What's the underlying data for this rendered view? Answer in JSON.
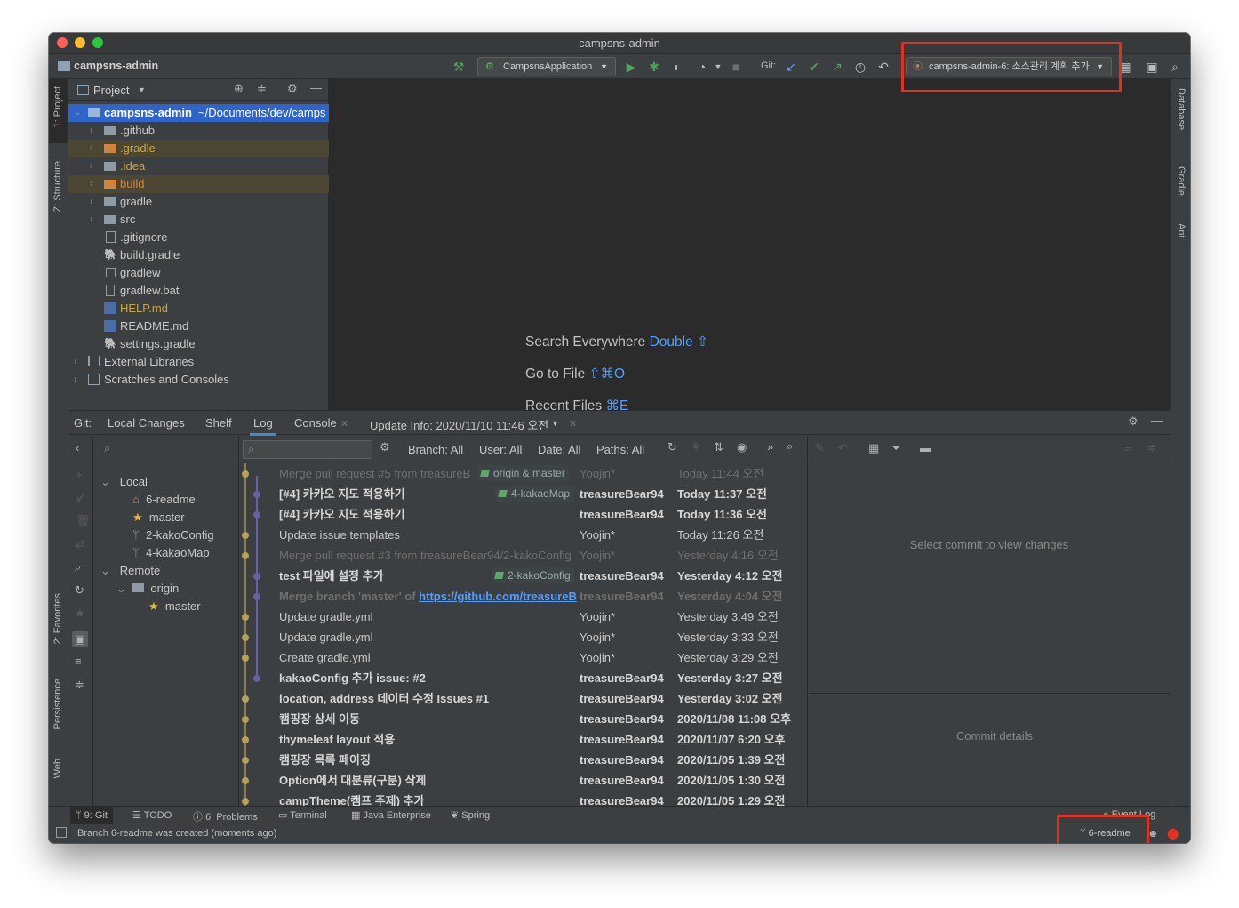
{
  "window": {
    "title": "campsns-admin"
  },
  "navbar": {
    "project": "campsns-admin",
    "run_config": "CampsnsApplication",
    "git_label": "Git:",
    "task": "campsns-admin-6: 소스관리 계획 추가"
  },
  "left_stripe": {
    "project": "1: Project",
    "structure": "Z: Structure",
    "favorites": "2: Favorites",
    "persistence": "Persistence",
    "web": "Web"
  },
  "right_stripe": {
    "database": "Database",
    "gradle": "Gradle",
    "ant": "Ant"
  },
  "project_panel": {
    "title": "Project",
    "root": {
      "name": "campsns-admin",
      "path": "~/Documents/dev/camps"
    },
    "items": [
      {
        "label": ".github"
      },
      {
        "label": ".gradle"
      },
      {
        "label": ".idea"
      },
      {
        "label": "build"
      },
      {
        "label": "gradle"
      },
      {
        "label": "src"
      },
      {
        "label": ".gitignore"
      },
      {
        "label": "build.gradle"
      },
      {
        "label": "gradlew"
      },
      {
        "label": "gradlew.bat"
      },
      {
        "label": "HELP.md"
      },
      {
        "label": "README.md"
      },
      {
        "label": "settings.gradle"
      },
      {
        "label": "External Libraries"
      },
      {
        "label": "Scratches and Consoles"
      }
    ]
  },
  "editor_hints": [
    {
      "text": "Search Everywhere",
      "key": "Double ⇧"
    },
    {
      "text": "Go to File",
      "key": "⇧⌘O"
    },
    {
      "text": "Recent Files",
      "key": "⌘E"
    }
  ],
  "git_panel": {
    "prefix": "Git:",
    "tabs": [
      "Local Changes",
      "Shelf",
      "Log",
      "Console",
      "Update Info: 2020/11/10 11:46 오전"
    ],
    "filters": {
      "branch": "Branch: All",
      "user": "User: All",
      "date": "Date: All",
      "paths": "Paths: All"
    },
    "branches": {
      "local": "Local",
      "local_items": [
        "6-readme",
        "master",
        "2-kakoConfig",
        "4-kakaoMap"
      ],
      "remote": "Remote",
      "origin": "origin",
      "origin_items": [
        "master"
      ]
    },
    "commits": [
      {
        "msg": "Merge pull request #5 from treasureB",
        "tag": "origin & master",
        "author": "Yoojin*",
        "date": "Today 11:44 오전"
      },
      {
        "msg": "[#4] 카카오 지도 적용하기",
        "tag": "4-kakaoMap",
        "author": "treasureBear94",
        "date": "Today 11:37 오전"
      },
      {
        "msg": "[#4] 카카오 지도 적용하기",
        "tag": "",
        "author": "treasureBear94",
        "date": "Today 11:36 오전"
      },
      {
        "msg": "Update issue templates",
        "tag": "",
        "author": "Yoojin*",
        "date": "Today 11:26 오전"
      },
      {
        "msg": "Merge pull request #3 from treasureBear94/2-kakoConfig",
        "tag": "",
        "author": "Yoojin*",
        "date": "Yesterday 4:16 오전"
      },
      {
        "msg": "test 파일에 설정 추가",
        "tag": "2-kakoConfig",
        "author": "treasureBear94",
        "date": "Yesterday 4:12 오전"
      },
      {
        "msg": "Merge branch 'master' of ",
        "link": "https://github.com/treasureB",
        "author": "treasureBear94",
        "date": "Yesterday 4:04 오전"
      },
      {
        "msg": "Update gradle.yml",
        "tag": "",
        "author": "Yoojin*",
        "date": "Yesterday 3:49 오전"
      },
      {
        "msg": "Update gradle.yml",
        "tag": "",
        "author": "Yoojin*",
        "date": "Yesterday 3:33 오전"
      },
      {
        "msg": "Create gradle.yml",
        "tag": "",
        "author": "Yoojin*",
        "date": "Yesterday 3:29 오전"
      },
      {
        "msg": "kakaoConfig 추가 issue: #2",
        "tag": "",
        "author": "treasureBear94",
        "date": "Yesterday 3:27 오전"
      },
      {
        "msg": "location, address 데이터 수정 Issues #1",
        "tag": "",
        "author": "treasureBear94",
        "date": "Yesterday 3:02 오전"
      },
      {
        "msg": "캠핑장 상세 이동",
        "tag": "",
        "author": "treasureBear94",
        "date": "2020/11/08 11:08 오후"
      },
      {
        "msg": "thymeleaf layout 적용",
        "tag": "",
        "author": "treasureBear94",
        "date": "2020/11/07 6:20 오후"
      },
      {
        "msg": "캠핑장 목록 페이징",
        "tag": "",
        "author": "treasureBear94",
        "date": "2020/11/05 1:39 오전"
      },
      {
        "msg": "Option에서 대분류(구분) 삭제",
        "tag": "",
        "author": "treasureBear94",
        "date": "2020/11/05 1:30 오전"
      },
      {
        "msg": "campTheme(캠프 주제) 추가",
        "tag": "",
        "author": "treasureBear94",
        "date": "2020/11/05 1:29 오전"
      }
    ],
    "select_commit_hint": "Select commit to view changes",
    "commit_details": "Commit details"
  },
  "bottom_tools": {
    "git": "9: Git",
    "todo": "TODO",
    "problems": "6: Problems",
    "terminal": "Terminal",
    "java_enterprise": "Java Enterprise",
    "spring": "Spring",
    "event_log": "Event Log"
  },
  "status": {
    "message": "Branch 6-readme was created (moments ago)",
    "branch": "6-readme"
  },
  "colors": {
    "accent": "#2f65ca",
    "highlight": "#e2321f",
    "run": "#4fa35a"
  }
}
